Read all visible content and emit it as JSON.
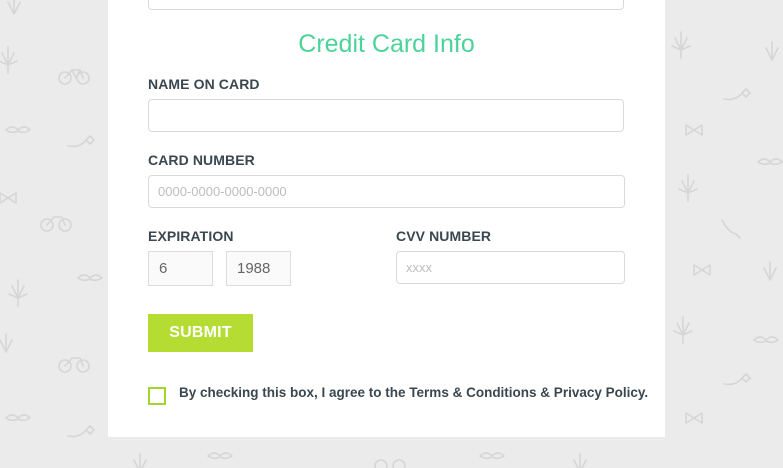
{
  "section": {
    "title": "Credit Card Info"
  },
  "fields": {
    "name_on_card": {
      "label": "NAME ON CARD",
      "value": "",
      "placeholder": ""
    },
    "card_number": {
      "label": "CARD NUMBER",
      "value": "",
      "placeholder": "0000-0000-0000-0000"
    },
    "expiration": {
      "label": "EXPIRATION",
      "month": "6",
      "year": "1988"
    },
    "cvv": {
      "label": "CVV NUMBER",
      "value": "",
      "placeholder": "xxxx"
    }
  },
  "submit": {
    "label": "SUBMIT"
  },
  "agreement": {
    "text": "By checking this box, I agree to the Terms & Conditions & Privacy Policy.",
    "checked": false
  },
  "colors": {
    "accent_title": "#4cd39a",
    "button": "#b4dc33",
    "checkbox_border": "#a3d62c",
    "page_background": "#ebebeb",
    "label_text": "#3a4750"
  },
  "background_icons": [
    "leaf-icon",
    "bicycle-icon",
    "mustache-icon",
    "pipe-icon",
    "bowtie-icon"
  ]
}
